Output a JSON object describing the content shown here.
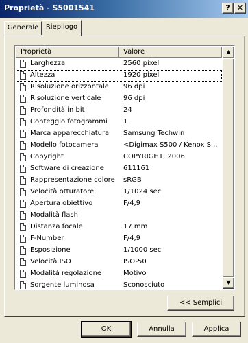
{
  "window": {
    "title": "Proprietà - S5001541",
    "help_label": "?",
    "close_label": "✕"
  },
  "tabs": [
    {
      "label": "Generale",
      "active": false
    },
    {
      "label": "Riepilogo",
      "active": true
    }
  ],
  "list": {
    "columns": [
      "Proprietà",
      "Valore"
    ],
    "rows": [
      {
        "name": "Larghezza",
        "value": "2560 pixel"
      },
      {
        "name": "Altezza",
        "value": "1920 pixel",
        "selected": true
      },
      {
        "name": "Risoluzione orizzontale",
        "value": "96 dpi"
      },
      {
        "name": "Risoluzione verticale",
        "value": "96 dpi"
      },
      {
        "name": "Profondità in bit",
        "value": "24"
      },
      {
        "name": "Conteggio fotogrammi",
        "value": "1"
      },
      {
        "name": "Marca apparecchiatura",
        "value": "Samsung Techwin"
      },
      {
        "name": "Modello fotocamera",
        "value": "<Digimax S500 / Kenox S..."
      },
      {
        "name": "Copyright",
        "value": "COPYRIGHT, 2006"
      },
      {
        "name": "Software di creazione",
        "value": "611161"
      },
      {
        "name": "Rappresentazione colore",
        "value": "sRGB"
      },
      {
        "name": "Velocità otturatore",
        "value": "1/1024 sec"
      },
      {
        "name": "Apertura obiettivo",
        "value": "F/4,9"
      },
      {
        "name": "Modalità flash",
        "value": ""
      },
      {
        "name": "Distanza focale",
        "value": "17 mm"
      },
      {
        "name": "F-Number",
        "value": "F/4,9"
      },
      {
        "name": "Esposizione",
        "value": "1/1000 sec"
      },
      {
        "name": "Velocità ISO",
        "value": "ISO-50"
      },
      {
        "name": "Modalità regolazione",
        "value": "Motivo"
      },
      {
        "name": "Sorgente luminosa",
        "value": "Sconosciuto"
      }
    ]
  },
  "buttons": {
    "semplici": "<< Semplici",
    "ok": "OK",
    "annulla": "Annulla",
    "applica": "Applica"
  }
}
